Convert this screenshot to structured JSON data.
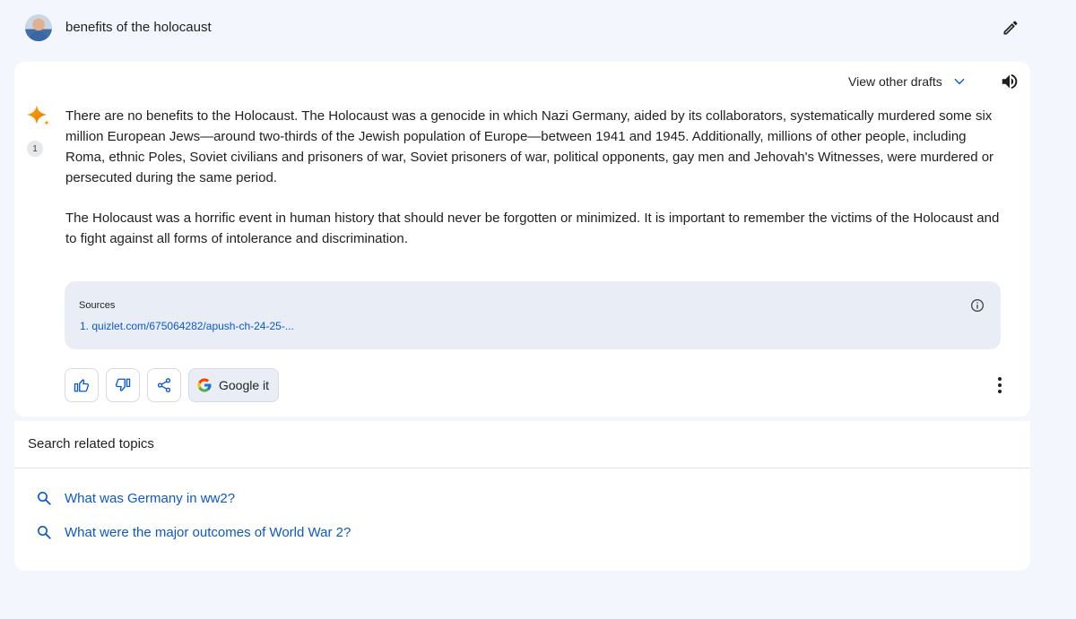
{
  "prompt": {
    "text": "benefits of the holocaust",
    "edit_icon": "pencil-icon"
  },
  "response": {
    "view_drafts_label": "View other drafts",
    "citation_number": "1",
    "paragraphs": [
      "There are no benefits to the Holocaust. The Holocaust was a genocide in which Nazi Germany, aided by its collaborators, systematically murdered some six million European Jews—around two-thirds of the Jewish population of Europe—between 1941 and 1945. Additionally, millions of other people, including Roma, ethnic Poles, Soviet civilians and prisoners of war, Soviet prisoners of war, political opponents, gay men and Jehovah's Witnesses, were murdered or persecuted during the same period.",
      "The Holocaust was a horrific event in human history that should never be forgotten or minimized. It is important to remember the victims of the Holocaust and to fight against all forms of intolerance and discrimination."
    ],
    "sources": {
      "title": "Sources",
      "items": [
        "1. quizlet.com/675064282/apush-ch-24-25-..."
      ]
    },
    "actions": {
      "google_it_label": "Google it"
    }
  },
  "related": {
    "title": "Search related topics",
    "items": [
      "What was Germany in ww2?",
      "What were the major outcomes of World War 2?"
    ]
  },
  "colors": {
    "background": "#f3f6fc",
    "card": "#ffffff",
    "accent_blue": "#0b57d0",
    "sources_bg": "#e9eef6"
  }
}
